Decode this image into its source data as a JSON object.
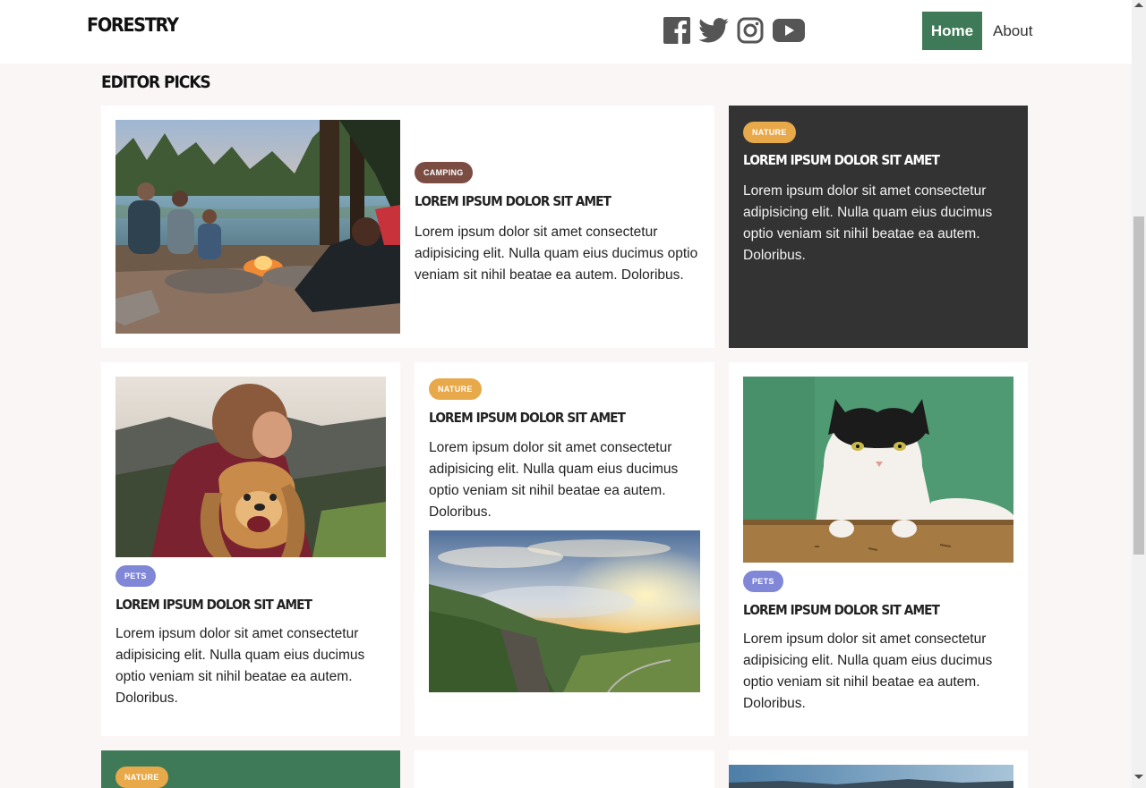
{
  "header": {
    "logo": "FORESTRY",
    "social": [
      "facebook-icon",
      "twitter-icon",
      "instagram-icon",
      "youtube-icon"
    ],
    "nav": {
      "home": "Home",
      "about": "About"
    }
  },
  "section": {
    "title": "EDITOR PICKS"
  },
  "colors": {
    "accent": "#3e7a57",
    "camping": "#7a4c42",
    "nature": "#e8a94a",
    "pets": "#7f87d6",
    "dark_card": "#333333"
  },
  "cards": [
    {
      "tag": "CAMPING",
      "title": "LOREM IPSUM DOLOR SIT AMET",
      "body": "Lorem ipsum dolor sit amet consectetur adipisicing elit. Nulla quam eius ducimus optio veniam sit nihil beatae ea autem. Doloribus.",
      "image": "campfire-photo"
    },
    {
      "tag": "NATURE",
      "title": "LOREM IPSUM DOLOR SIT AMET",
      "body": "Lorem ipsum dolor sit amet consectetur adipisicing elit. Nulla quam eius ducimus optio veniam sit nihil beatae ea autem. Doloribus."
    },
    {
      "tag": "PETS",
      "title": "LOREM IPSUM DOLOR SIT AMET",
      "body": "Lorem ipsum dolor sit amet consectetur adipisicing elit. Nulla quam eius ducimus optio veniam sit nihil beatae ea autem. Doloribus.",
      "image": "man-with-dog-photo"
    },
    {
      "tag": "NATURE",
      "title": "LOREM IPSUM DOLOR SIT AMET",
      "body": "Lorem ipsum dolor sit amet consectetur adipisicing elit. Nulla quam eius ducimus optio veniam sit nihil beatae ea autem. Doloribus.",
      "image": "valley-sunset-photo"
    },
    {
      "tag": "PETS",
      "title": "LOREM IPSUM DOLOR SIT AMET",
      "body": "Lorem ipsum dolor sit amet consectetur adipisicing elit. Nulla quam eius ducimus optio veniam sit nihil beatae ea autem. Doloribus.",
      "image": "cat-photo"
    },
    {
      "tag": "NATURE"
    }
  ]
}
